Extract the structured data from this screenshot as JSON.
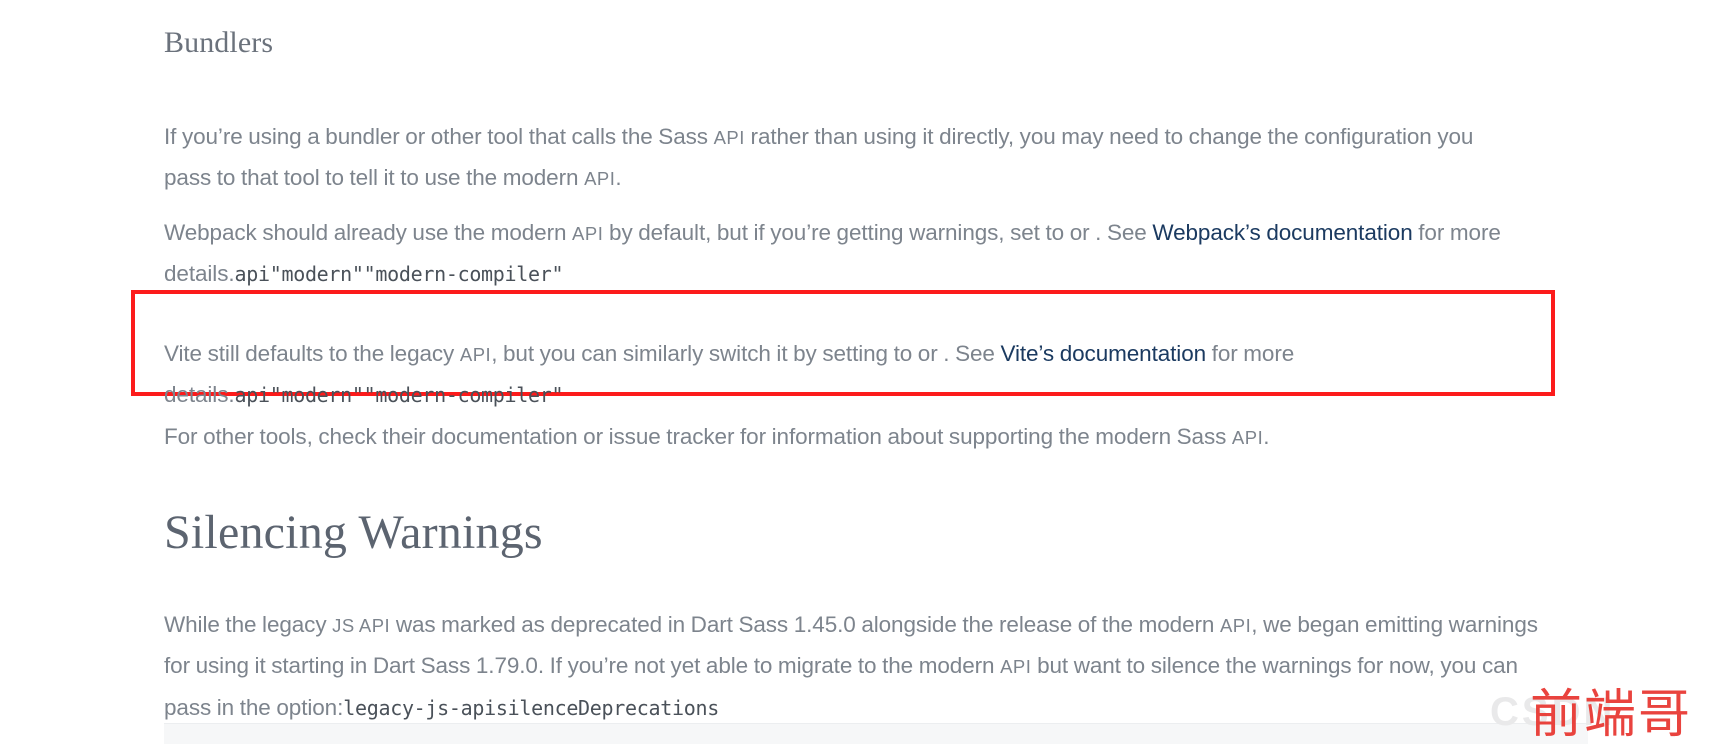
{
  "document": {
    "section_bundlers": {
      "heading": "Bundlers",
      "paragraph_1": {
        "part_1": "If you’re using a bundler or other tool that calls the Sass ",
        "code_1": "API",
        "part_2": " rather than using it directly, you may need to change the configuration you pass to that tool to tell it to use the modern ",
        "code_2": "API",
        "part_3": "."
      },
      "paragraph_2": {
        "part_1": "Webpack should already use the modern ",
        "code_1": "API",
        "part_2": " by default, but if you’re getting warnings, set to or . See ",
        "link_label": "Webpack’s documentation",
        "part_3": " for more details.",
        "code_tail": "api\"modern\"\"modern-compiler\""
      },
      "paragraph_3_highlighted": {
        "part_1": "Vite still defaults to the legacy ",
        "code_1": "API",
        "part_2": ", but you can similarly switch it by setting to or . See ",
        "link_label": "Vite’s documentation",
        "part_3": " for more details.",
        "code_tail": "api\"modern\"\"modern-compiler\""
      },
      "paragraph_4": {
        "part_1": "For other tools, check their documentation or issue tracker for information about supporting the modern Sass ",
        "code_1": "API",
        "part_2": "."
      }
    },
    "section_silencing": {
      "heading": "Silencing Warnings",
      "paragraph_1": {
        "part_1": "While the legacy ",
        "code_1": "JS API",
        "part_2": " was marked as deprecated in Dart Sass 1.45.0 alongside the release of the modern ",
        "code_2": "API",
        "part_3": ", we began emitting warnings for using it starting in Dart Sass 1.79.0. If you’re not yet able to migrate to the modern ",
        "code_3": "API",
        "part_4": " but want to silence the warnings for now, you can pass in the option:",
        "code_tail": "legacy-js-apisilenceDeprecations"
      }
    }
  },
  "annotation": {
    "highlight_box_color": "#fc1b1b",
    "highlight_box_label": "vite-paragraph-highlight"
  },
  "watermark": {
    "site_text": "CSDN",
    "author_text": "前端哥",
    "author_color": "#e8342e",
    "site_color": "#e9e9ea"
  },
  "theme": {
    "background": "#ffffff",
    "body_text": "#7d848d",
    "heading_text": "#5c6470",
    "link": "#1b3a60",
    "code_text": "#4a5159",
    "code_block_bg": "#f6f7f8"
  }
}
